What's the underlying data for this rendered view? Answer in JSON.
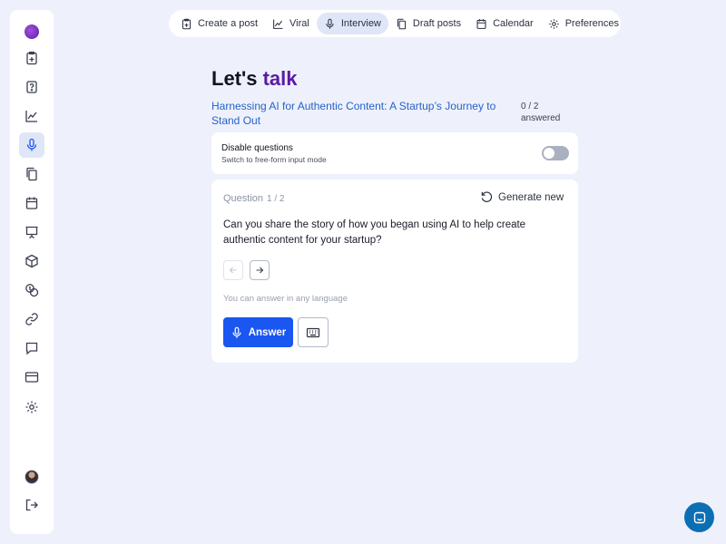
{
  "nav": {
    "items": [
      {
        "label": "Create a post",
        "icon": "clipboard-plus-icon",
        "active": false
      },
      {
        "label": "Viral",
        "icon": "chart-line-icon",
        "active": false
      },
      {
        "label": "Interview",
        "icon": "microphone-icon",
        "active": true
      },
      {
        "label": "Draft posts",
        "icon": "copy-icon",
        "active": false
      },
      {
        "label": "Calendar",
        "icon": "calendar-icon",
        "active": false
      },
      {
        "label": "Preferences",
        "icon": "gear-icon",
        "active": false
      }
    ]
  },
  "sidebar": {
    "items": [
      {
        "icon": "clipboard-plus-icon"
      },
      {
        "icon": "question-icon"
      },
      {
        "icon": "chart-line-icon"
      },
      {
        "icon": "microphone-icon",
        "active": true
      },
      {
        "icon": "copy-icon"
      },
      {
        "icon": "calendar-icon"
      },
      {
        "icon": "presentation-icon"
      },
      {
        "icon": "cube-icon"
      },
      {
        "icon": "coins-icon"
      },
      {
        "icon": "link-icon"
      },
      {
        "icon": "chat-icon"
      },
      {
        "icon": "credit-card-icon"
      },
      {
        "icon": "gear-icon"
      }
    ]
  },
  "page": {
    "title_prefix": "Let's ",
    "title_accent": "talk",
    "subtitle": "Harnessing AI for Authentic Content: A Startup’s Journey to Stand Out",
    "progress_count": "0 / 2",
    "progress_label": "answered"
  },
  "toggle": {
    "title": "Disable questions",
    "subtitle": "Switch to free-form input mode",
    "on": false
  },
  "question": {
    "label": "Question",
    "count": "1 / 2",
    "generate_label": "Generate new",
    "text": "Can you share the story of how you began using AI to help create authentic content for your startup?",
    "hint": "You can answer in any language",
    "answer_label": "Answer"
  },
  "colors": {
    "accent": "#5a1aa8",
    "primary": "#1a56f0",
    "link": "#2563c9",
    "background": "#eef1fb"
  }
}
